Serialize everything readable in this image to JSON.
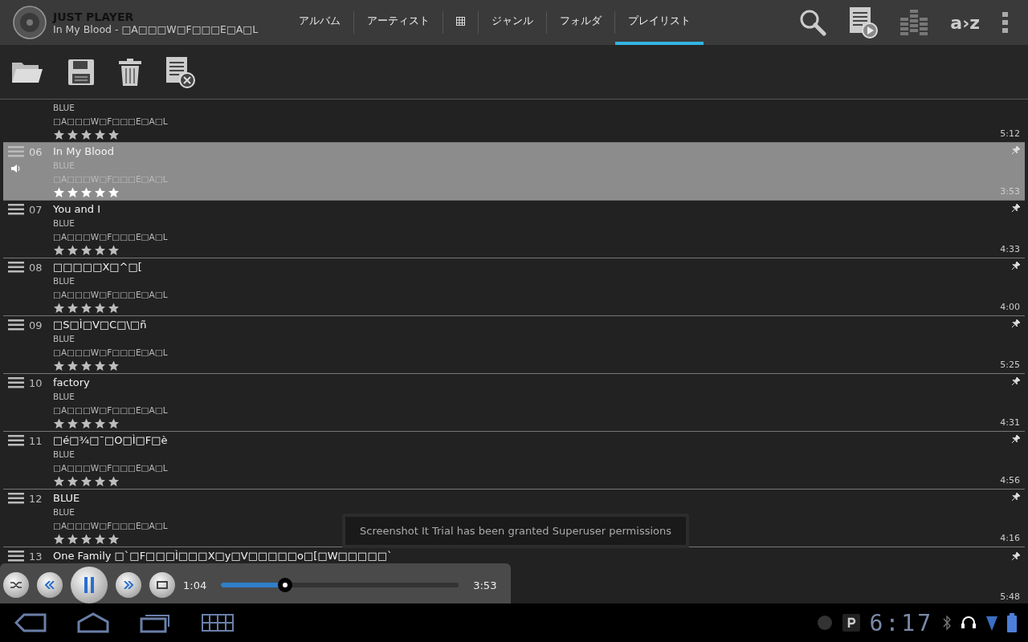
{
  "app": {
    "title": "JUST PLAYER",
    "now_playing": "In My Blood - □A□□□W□F□□□E□A□L"
  },
  "tabs": [
    {
      "kind": "text",
      "label": "アルバム",
      "selected": false
    },
    {
      "kind": "text",
      "label": "アーティスト",
      "selected": false
    },
    {
      "kind": "icon",
      "selected": false
    },
    {
      "kind": "text",
      "label": "ジャンル",
      "selected": false
    },
    {
      "kind": "text",
      "label": "フォルダ",
      "selected": false
    },
    {
      "kind": "text",
      "label": "プレイリスト",
      "selected": true
    }
  ],
  "sort_label": "a›z",
  "tracks": [
    {
      "artist": "BLUE",
      "album": "□A□□□W□F□□□E□A□L",
      "stars": 5,
      "duration": "5:12",
      "selected": false
    },
    {
      "number": "06",
      "title": "In My Blood",
      "artist": "BLUE",
      "album": "□A□□□W□F□□□E□A□L",
      "stars": 5,
      "duration": "3:53",
      "selected": true
    },
    {
      "number": "07",
      "title": "You and I",
      "artist": "BLUE",
      "album": "□A□□□W□F□□□E□A□L",
      "stars": 5,
      "duration": "4:33",
      "selected": false
    },
    {
      "number": "08",
      "title": "□□□□□X□^□[",
      "artist": "BLUE",
      "album": "□A□□□W□F□□□E□A□L",
      "stars": 5,
      "duration": "4:00",
      "selected": false
    },
    {
      "number": "09",
      "title": "□S□Ì□V□C□\\□ñ",
      "artist": "BLUE",
      "album": "□A□□□W□F□□□E□A□L",
      "stars": 5,
      "duration": "5:25",
      "selected": false
    },
    {
      "number": "10",
      "title": "factory",
      "artist": "BLUE",
      "album": "□A□□□W□F□□□E□A□L",
      "stars": 5,
      "duration": "4:31",
      "selected": false
    },
    {
      "number": "11",
      "title": "□é□¾□¯□O□Ì□F□è",
      "artist": "BLUE",
      "album": "□A□□□W□F□□□E□A□L",
      "stars": 5,
      "duration": "4:56",
      "selected": false
    },
    {
      "number": "12",
      "title": "BLUE",
      "artist": "BLUE",
      "album": "□A□□□W□F□□□E□A□L",
      "stars": 5,
      "duration": "4:16",
      "selected": false
    }
  ],
  "last_track": {
    "number": "13",
    "title": "One Family □`□F□□□Ì□□□X□y□V□□□□□o□[□W□□□□□`",
    "duration": "5:48"
  },
  "player": {
    "elapsed": "1:04",
    "level": 0.27,
    "total": "3:53"
  },
  "toast": "Screenshot It Trial has been granted Superuser permissions",
  "status_bar": {
    "time": "6:17"
  }
}
